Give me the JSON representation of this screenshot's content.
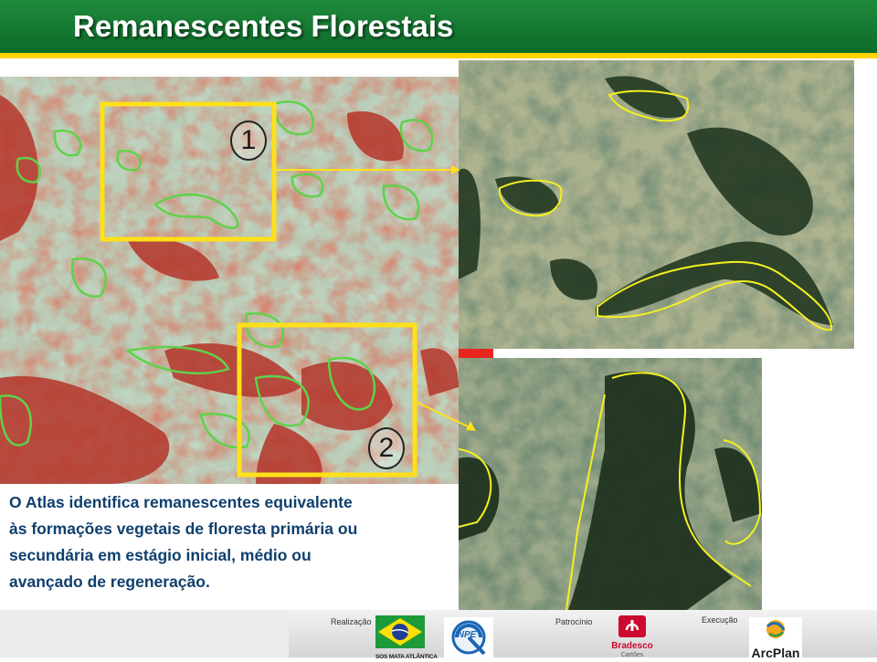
{
  "slide": {
    "title": "Remanescentes Florestais",
    "caption_lines": [
      "O Atlas identifica remanescentes equivalente",
      "às formações vegetais de floresta primária ou",
      "secundária em estágio inicial, médio ou",
      "avançado de regeneração."
    ],
    "markers": [
      "1",
      "2"
    ]
  },
  "footer": {
    "realizacao_label": "Realização",
    "patrocinio_label": "Patrocínio",
    "execucao_label": "Execução",
    "logos": {
      "sos": "SOS MATA ATLÂNTICA",
      "inpe": "INPE",
      "bradesco": "Bradesco",
      "bradesco_sub": "Cartões",
      "arcplan": "ArcPlan"
    }
  },
  "colors": {
    "header_green": "#0d6b2a",
    "header_stripe": "#ffd400",
    "caption_blue": "#0f3f6d",
    "box_yellow": "#ffe01a",
    "outline_green": "#5fd24a",
    "outline_yellow": "#f4f021"
  }
}
